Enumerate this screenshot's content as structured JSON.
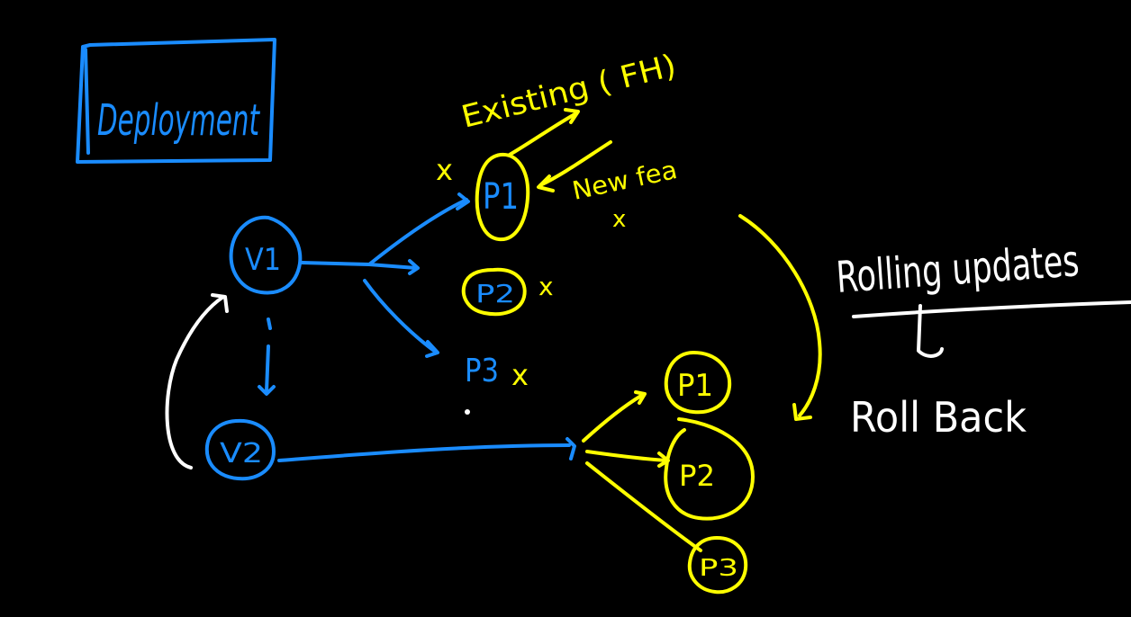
{
  "colors": {
    "background": "#000000",
    "blue": "#1a8cff",
    "yellow": "#ffff00",
    "white": "#ffffff"
  },
  "title": "Deployment",
  "versions": {
    "v1": "V1",
    "v2": "V2"
  },
  "v1_pods": {
    "p1": "P1",
    "p2": "P2",
    "p3": "P3"
  },
  "v2_pods": {
    "p1": "P1",
    "p2": "P2",
    "p3": "P3"
  },
  "annotations": {
    "existing": "Existing ( FH)",
    "new_fea": "New fea",
    "cross": "x"
  },
  "notes": {
    "rolling_updates": "Rolling updates",
    "roll_back": "Roll Back"
  }
}
